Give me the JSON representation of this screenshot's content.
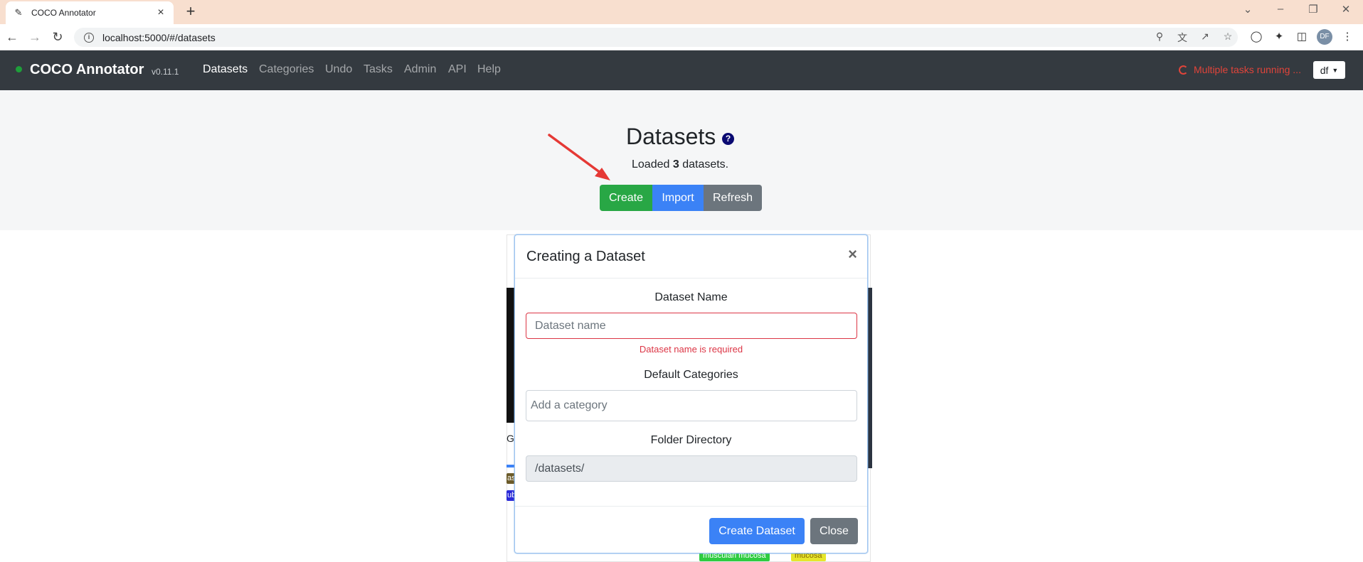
{
  "browser": {
    "tab_title": "COCO Annotator",
    "url": "localhost:5000/#/datasets",
    "profile_initials": "DF"
  },
  "app": {
    "brand": "COCO Annotator",
    "version": "v0.11.1",
    "nav": [
      "Datasets",
      "Categories",
      "Undo",
      "Tasks",
      "Admin",
      "API",
      "Help"
    ],
    "active_nav": "Datasets",
    "tasks_status": "Multiple tasks running ...",
    "user_menu": "df"
  },
  "page": {
    "title": "Datasets",
    "loaded_prefix": "Loaded ",
    "loaded_count": "3",
    "loaded_suffix": " datasets.",
    "buttons": {
      "create": "Create",
      "import": "Import",
      "refresh": "Refresh"
    }
  },
  "background_cards": {
    "card1_title_fragment": "G",
    "card1_tags": [
      "as",
      "ub"
    ],
    "card2_tags": [
      "musculari mucosa",
      "mucosa"
    ]
  },
  "modal": {
    "title": "Creating a Dataset",
    "close_glyph": "×",
    "name_label": "Dataset Name",
    "name_placeholder": "Dataset name",
    "name_error": "Dataset name is required",
    "categories_label": "Default Categories",
    "categories_placeholder": "Add a category",
    "folder_label": "Folder Directory",
    "folder_value": "/datasets/",
    "create_button": "Create Dataset",
    "close_button": "Close"
  },
  "colors": {
    "navbar_bg": "#343a40",
    "success": "#28a745",
    "primary": "#3b82f6",
    "secondary": "#6c757d",
    "danger": "#dc3545",
    "annotation_arrow": "#e53935"
  }
}
